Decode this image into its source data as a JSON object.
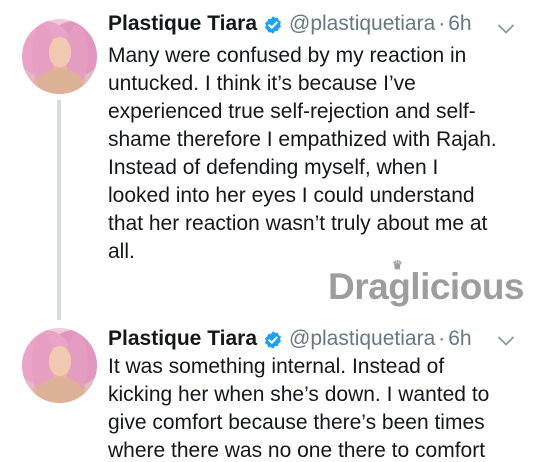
{
  "tweets": [
    {
      "display_name": "Plastique Tiara",
      "handle": "@plastiquetiara",
      "separator": "·",
      "time": "6h",
      "lines": [
        "Many were confused by my reaction in",
        "untucked. I think it’s because I’ve",
        "experienced true self-rejection and self-",
        "shame therefore I empathized with Rajah.",
        "Instead of defending myself, when I",
        "looked into her eyes I could understand",
        "that her reaction wasn’t truly about me at",
        "all."
      ]
    },
    {
      "display_name": "Plastique Tiara",
      "handle": "@plastiquetiara",
      "separator": "·",
      "time": "6h",
      "lines": [
        "It was something internal. Instead of",
        "kicking her when she’s down. I wanted to",
        "give comfort because there’s been times",
        "where there was no one there to comfort"
      ]
    }
  ],
  "watermark": {
    "text": "Draglicious",
    "crown": "♛"
  },
  "icons": {
    "verified": "verified-badge-icon",
    "menu": "chevron-down-icon"
  },
  "colors": {
    "name": "#14171a",
    "meta": "#657786",
    "verified": "#1da1f2",
    "thread_line": "#d5dbe0"
  }
}
